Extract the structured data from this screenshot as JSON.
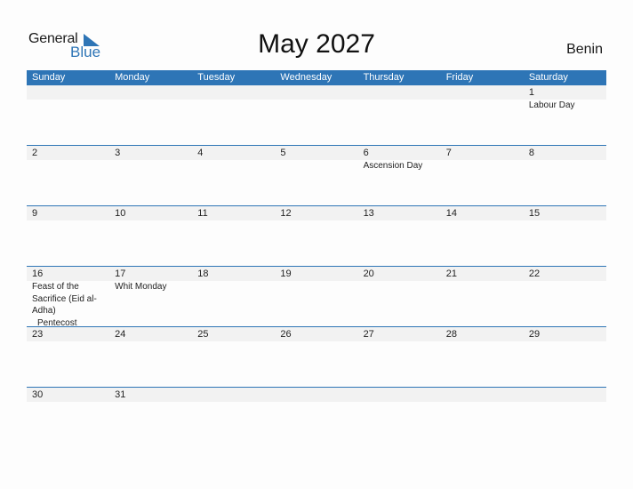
{
  "brand": {
    "name_part1": "General",
    "name_part2": "Blue",
    "accent": "#2e75b6"
  },
  "title": "May 2027",
  "country": "Benin",
  "weekdays": [
    "Sunday",
    "Monday",
    "Tuesday",
    "Wednesday",
    "Thursday",
    "Friday",
    "Saturday"
  ],
  "weeks": [
    [
      {
        "day": "",
        "events": []
      },
      {
        "day": "",
        "events": []
      },
      {
        "day": "",
        "events": []
      },
      {
        "day": "",
        "events": []
      },
      {
        "day": "",
        "events": []
      },
      {
        "day": "",
        "events": []
      },
      {
        "day": "1",
        "events": [
          "Labour Day"
        ]
      }
    ],
    [
      {
        "day": "2",
        "events": []
      },
      {
        "day": "3",
        "events": []
      },
      {
        "day": "4",
        "events": []
      },
      {
        "day": "5",
        "events": []
      },
      {
        "day": "6",
        "events": [
          "Ascension Day"
        ]
      },
      {
        "day": "7",
        "events": []
      },
      {
        "day": "8",
        "events": []
      }
    ],
    [
      {
        "day": "9",
        "events": []
      },
      {
        "day": "10",
        "events": []
      },
      {
        "day": "11",
        "events": []
      },
      {
        "day": "12",
        "events": []
      },
      {
        "day": "13",
        "events": []
      },
      {
        "day": "14",
        "events": []
      },
      {
        "day": "15",
        "events": []
      }
    ],
    [
      {
        "day": "16",
        "events": [
          "Feast of the Sacrifice (Eid al-Adha)",
          "Pentecost"
        ]
      },
      {
        "day": "17",
        "events": [
          "Whit Monday"
        ]
      },
      {
        "day": "18",
        "events": []
      },
      {
        "day": "19",
        "events": []
      },
      {
        "day": "20",
        "events": []
      },
      {
        "day": "21",
        "events": []
      },
      {
        "day": "22",
        "events": []
      }
    ],
    [
      {
        "day": "23",
        "events": []
      },
      {
        "day": "24",
        "events": []
      },
      {
        "day": "25",
        "events": []
      },
      {
        "day": "26",
        "events": []
      },
      {
        "day": "27",
        "events": []
      },
      {
        "day": "28",
        "events": []
      },
      {
        "day": "29",
        "events": []
      }
    ],
    [
      {
        "day": "30",
        "events": []
      },
      {
        "day": "31",
        "events": []
      },
      {
        "day": "",
        "events": []
      },
      {
        "day": "",
        "events": []
      },
      {
        "day": "",
        "events": []
      },
      {
        "day": "",
        "events": []
      },
      {
        "day": "",
        "events": []
      }
    ]
  ]
}
